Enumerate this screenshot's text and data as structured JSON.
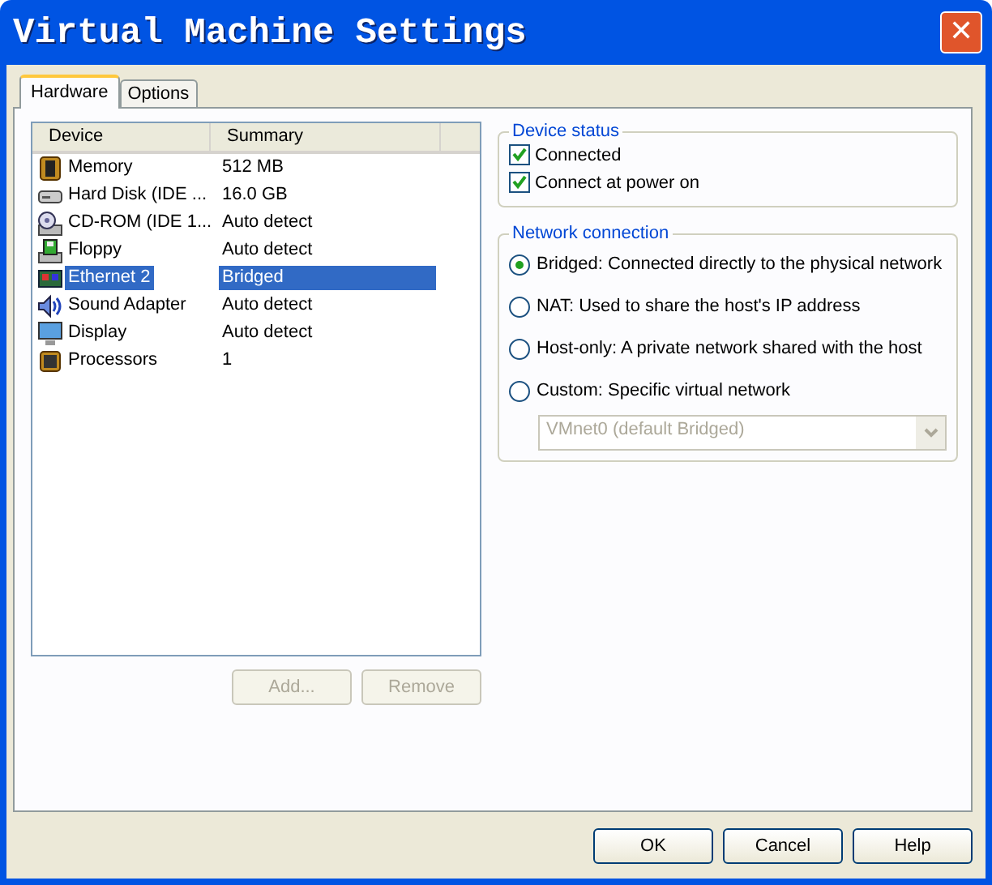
{
  "window": {
    "title": "Virtual Machine Settings",
    "close": "✕"
  },
  "tabs": [
    {
      "label": "Hardware",
      "selected": true
    },
    {
      "label": "Options",
      "selected": false
    }
  ],
  "device_list": {
    "columns": [
      "Device",
      "Summary"
    ],
    "rows": [
      {
        "kind": "memory",
        "device": "Memory",
        "summary": "512 MB",
        "selected": false
      },
      {
        "kind": "disk",
        "device": "Hard Disk (IDE ...",
        "summary": "16.0 GB",
        "selected": false
      },
      {
        "kind": "cdrom",
        "device": "CD-ROM (IDE 1...",
        "summary": "Auto detect",
        "selected": false
      },
      {
        "kind": "floppy",
        "device": "Floppy",
        "summary": "Auto detect",
        "selected": false
      },
      {
        "kind": "ethernet",
        "device": "Ethernet 2",
        "summary": "Bridged",
        "selected": true
      },
      {
        "kind": "sound",
        "device": "Sound Adapter",
        "summary": "Auto detect",
        "selected": false
      },
      {
        "kind": "display",
        "device": "Display",
        "summary": "Auto detect",
        "selected": false
      },
      {
        "kind": "cpu",
        "device": "Processors",
        "summary": "1",
        "selected": false
      }
    ]
  },
  "list_buttons": [
    {
      "label": "Add...",
      "disabled": true
    },
    {
      "label": "Remove",
      "disabled": true
    }
  ],
  "device_status": {
    "title": "Device status",
    "options": [
      {
        "label": "Connected",
        "checked": true
      },
      {
        "label": "Connect at power on",
        "checked": true
      }
    ]
  },
  "network_connection": {
    "title": "Network connection",
    "options": [
      {
        "label": "Bridged: Connected directly to the physical network",
        "selected": true
      },
      {
        "label": "NAT: Used to share the host's IP address",
        "selected": false
      },
      {
        "label": "Host-only: A private network shared with the host",
        "selected": false
      },
      {
        "label": "Custom: Specific virtual network",
        "selected": false
      }
    ],
    "network_select": {
      "value": "VMnet0 (default Bridged)",
      "disabled": true
    }
  },
  "footer_buttons": [
    {
      "label": "OK"
    },
    {
      "label": "Cancel"
    },
    {
      "label": "Help"
    }
  ]
}
